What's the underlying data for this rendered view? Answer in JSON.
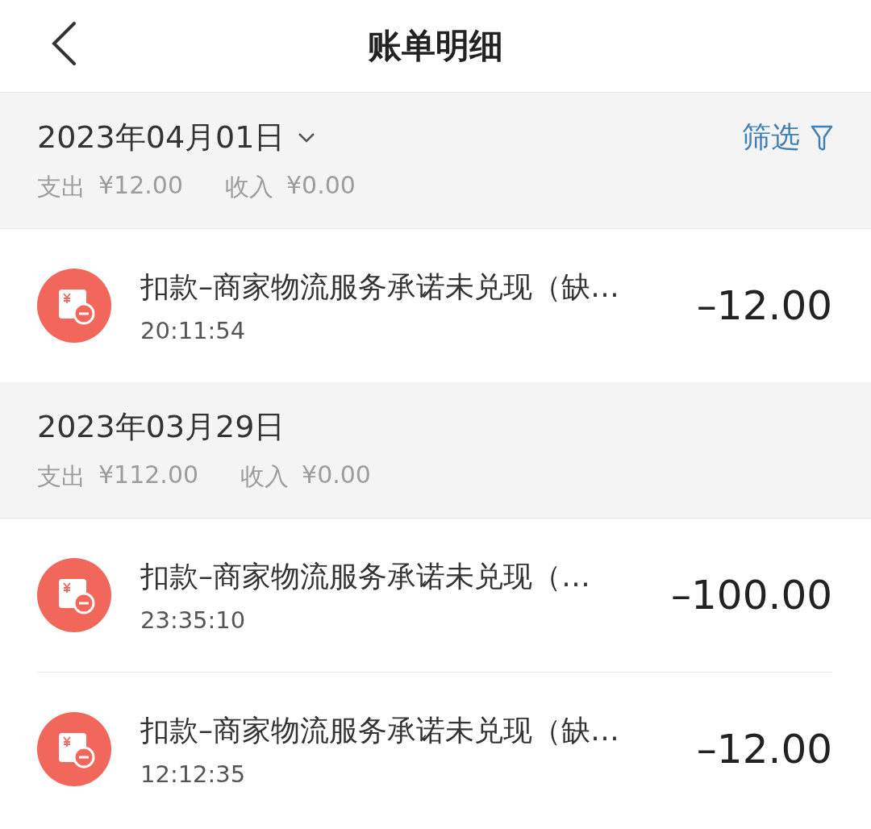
{
  "header": {
    "title": "账单明细"
  },
  "sections": [
    {
      "date": "2023年04月01日",
      "dropdown": true,
      "filter": "筛选",
      "expense_label": "支出",
      "expense": "¥12.00",
      "income_label": "收入",
      "income": "¥0.00",
      "items": [
        {
          "title": "扣款–商家物流服务承诺未兑现（缺…",
          "time": "20:11:54",
          "amount": "–12.00"
        }
      ]
    },
    {
      "date": "2023年03月29日",
      "dropdown": false,
      "expense_label": "支出",
      "expense": "¥112.00",
      "income_label": "收入",
      "income": "¥0.00",
      "items": [
        {
          "title": "扣款–商家物流服务承诺未兑现（…",
          "time": "23:35:10",
          "amount": "–100.00"
        },
        {
          "title": "扣款–商家物流服务承诺未兑现（缺…",
          "time": "12:12:35",
          "amount": "–12.00"
        }
      ]
    }
  ]
}
